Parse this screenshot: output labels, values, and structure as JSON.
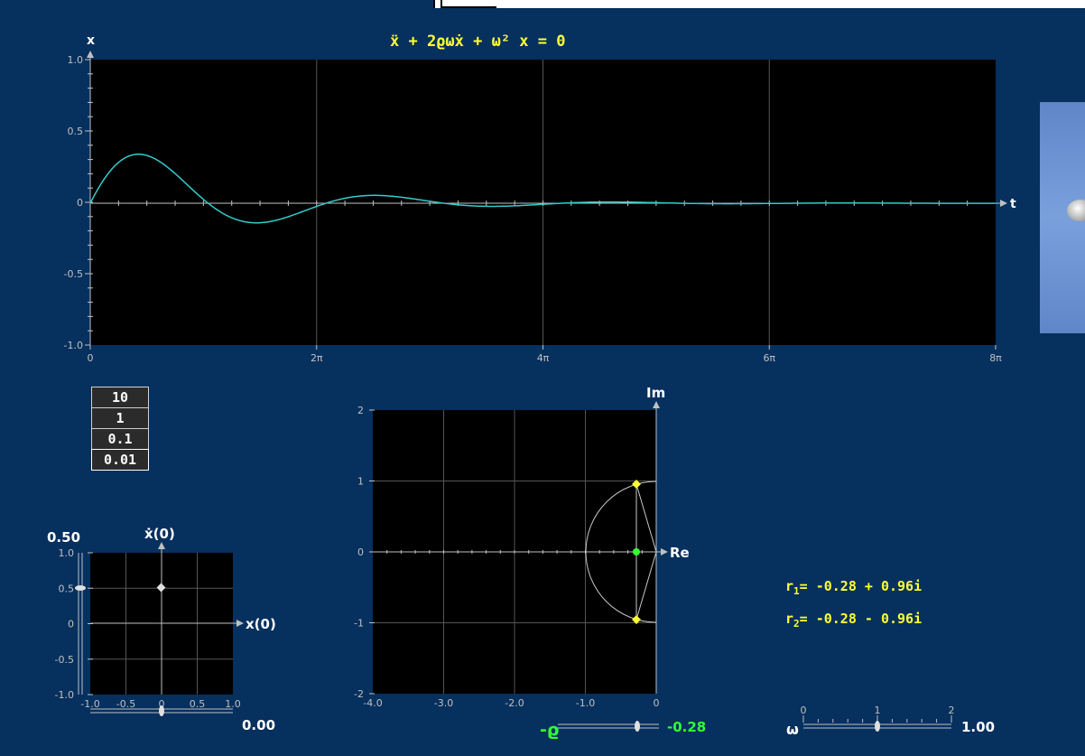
{
  "equation": "ẍ + 2ϱωẋ + ω² x = 0",
  "main_plot": {
    "y_axis_label": "x",
    "x_axis_label": "t",
    "y_ticks": [
      "1.0",
      "0.5",
      "0",
      "-0.5",
      "-1.0"
    ],
    "x_ticks": [
      "0",
      "2π",
      "4π",
      "6π",
      "8π"
    ]
  },
  "scale_buttons": [
    "10",
    "1",
    "0.1",
    "0.01"
  ],
  "phase_plot": {
    "y_axis_label": "ẋ(0)",
    "x_axis_label": "x(0)",
    "y_ticks": [
      "1.0",
      "0.5",
      "0",
      "-0.5",
      "-1.0"
    ],
    "x_ticks": [
      "-1.0",
      "-0.5",
      "0",
      "0.5",
      "1.0"
    ],
    "initial_velocity": "0.50",
    "initial_position": "0.00"
  },
  "complex_plane": {
    "y_axis_label": "Im",
    "x_axis_label": "Re",
    "y_ticks": [
      "2",
      "1",
      "0",
      "-1",
      "-2"
    ],
    "x_ticks": [
      "-4.0",
      "-3.0",
      "-2.0",
      "-1.0",
      "0"
    ]
  },
  "damping": {
    "symbol": "-ϱ",
    "value": "-0.28",
    "level": 0.28
  },
  "omega": {
    "symbol": "ω",
    "ticks": [
      "0",
      "1",
      "2"
    ],
    "value": "1.00"
  },
  "roots": {
    "r1_label": "r",
    "r1_sub": "1",
    "r1_value": "= -0.28 + 0.96i",
    "r2_label": "r",
    "r2_sub": "2",
    "r2_value": "= -0.28 - 0.96i"
  },
  "colors": {
    "background": "#06305e",
    "plot_bg": "#000000",
    "curve": "#33cccc",
    "highlight": "#ffff33",
    "accent_green": "#33ff33"
  }
}
